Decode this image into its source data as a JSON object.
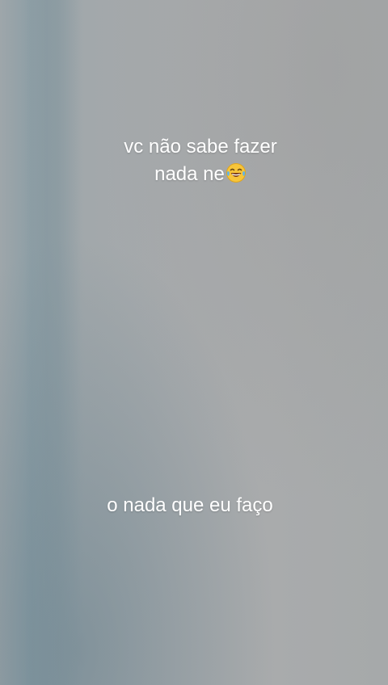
{
  "captions": {
    "top_line_1": "vc não sabe fazer",
    "top_line_2": "nada ne",
    "top_emoji": "laughing-tears-emoji",
    "bottom": "o nada que eu faço"
  },
  "colors": {
    "text": "#ffffff",
    "background": "#a9acad"
  }
}
